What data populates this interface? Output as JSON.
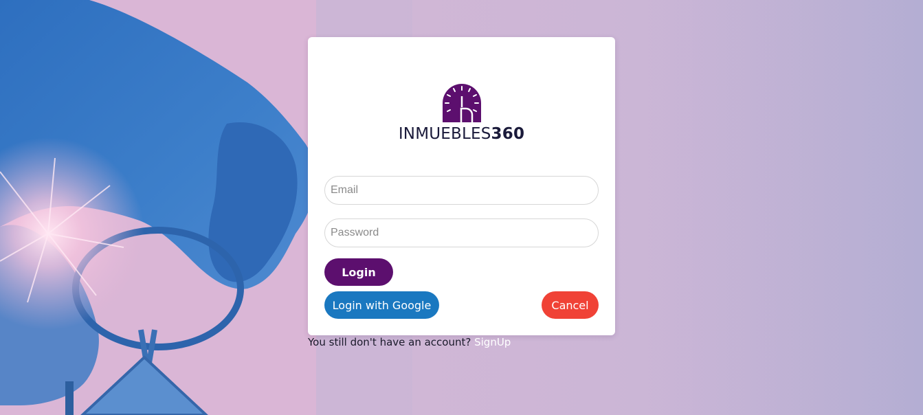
{
  "brand": {
    "name_part1": "INMUEBLES",
    "name_part2": "360",
    "primary_color": "#5c0f6e"
  },
  "login_form": {
    "email_placeholder": "Email",
    "password_placeholder": "Password",
    "email_value": "",
    "password_value": "",
    "login_label": "Login",
    "google_label": "Login with Google",
    "cancel_label": "Cancel"
  },
  "signup": {
    "prompt": "You still don't have an account?",
    "link_label": "SignUp"
  },
  "colors": {
    "login_button": "#5c0f6e",
    "google_button": "#1a78c0",
    "cancel_button": "#f04236",
    "background": "#ccb6d6",
    "photo_tint": "#3f7cc4"
  },
  "icons": {
    "logo": "house-speedometer-logo-icon"
  }
}
